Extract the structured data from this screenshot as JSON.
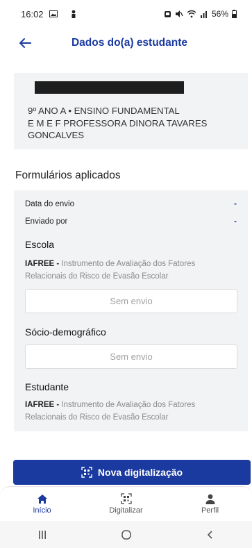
{
  "status_bar": {
    "time": "16:02",
    "battery": "56%"
  },
  "header": {
    "title": "Dados do(a) estudante"
  },
  "student": {
    "class_line": "9º ANO A • ENSINO FUNDAMENTAL",
    "school_line1": "E M E F PROFESSORA DINORA TAVARES",
    "school_line2": "GONCALVES"
  },
  "forms": {
    "section_title": "Formulários aplicados",
    "date_label": "Data do envio",
    "date_value": "-",
    "sender_label": "Enviado por",
    "sender_value": "-",
    "groups": [
      {
        "title": "Escola",
        "instrument_code": "IAFREE - ",
        "instrument_name": "Instrumento de Avaliação dos Fatores Relacionais do Risco de Evasão Escolar",
        "status": "Sem envio"
      },
      {
        "title": "Sócio-demográfico",
        "status": "Sem envio"
      },
      {
        "title": "Estudante",
        "instrument_code": "IAFREE - ",
        "instrument_name": "Instrumento de Avaliação dos Fatores Relacionais do Risco de Evasão Escolar"
      }
    ]
  },
  "scan_button": {
    "label": "Nova digitalização"
  },
  "bottom_nav": {
    "items": [
      {
        "label": "Início"
      },
      {
        "label": "Digitalizar"
      },
      {
        "label": "Perfil"
      }
    ]
  },
  "colors": {
    "primary": "#1a3aa0",
    "card_bg": "#f2f3f5",
    "muted_text": "#8a8a8a"
  }
}
